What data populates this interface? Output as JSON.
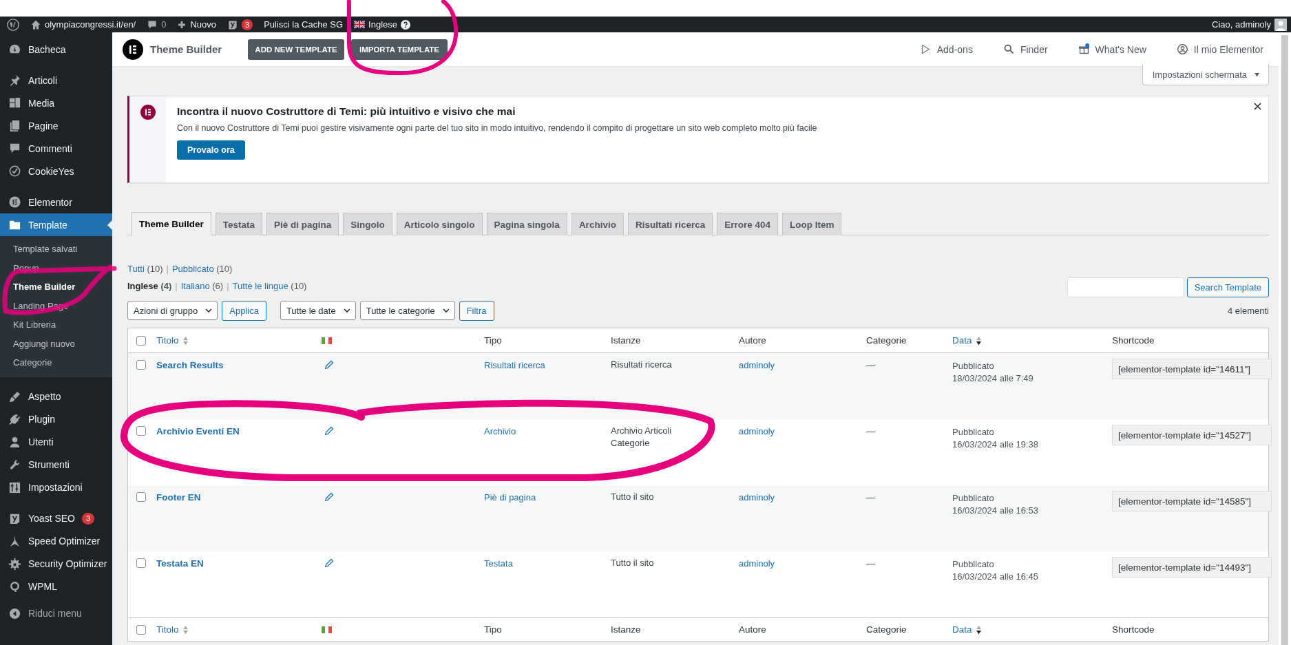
{
  "admin_bar": {
    "site": "olympiacongressi.it/en/",
    "comments": "0",
    "new_label": "Nuovo",
    "seo_count": "3",
    "cache_label": "Pulisci la Cache SG",
    "language": "Inglese",
    "greeting": "Ciao, adminoly"
  },
  "sidebar": {
    "items": [
      {
        "label": "Bacheca",
        "selected": false
      },
      {
        "label": "Articoli",
        "selected": false
      },
      {
        "label": "Media",
        "selected": false
      },
      {
        "label": "Pagine",
        "selected": false
      },
      {
        "label": "Commenti",
        "selected": false
      },
      {
        "label": "CookieYes",
        "selected": false
      },
      {
        "label": "Elementor",
        "selected": false
      },
      {
        "label": "Template",
        "selected": true,
        "children": [
          {
            "label": "Template salvati",
            "selected": false
          },
          {
            "label": "Popup",
            "selected": false
          },
          {
            "label": "Theme Builder",
            "selected": true
          },
          {
            "label": "Landing Page",
            "selected": false
          },
          {
            "label": "Kit Libreria",
            "selected": false
          },
          {
            "label": "Aggiungi nuovo",
            "selected": false
          },
          {
            "label": "Categorie",
            "selected": false
          }
        ]
      },
      {
        "label": "Aspetto",
        "selected": false
      },
      {
        "label": "Plugin",
        "selected": false
      },
      {
        "label": "Utenti",
        "selected": false
      },
      {
        "label": "Strumenti",
        "selected": false
      },
      {
        "label": "Impostazioni",
        "selected": false
      },
      {
        "label": "Yoast SEO",
        "selected": false,
        "badge": "3"
      },
      {
        "label": "Speed Optimizer",
        "selected": false
      },
      {
        "label": "Security Optimizer",
        "selected": false
      },
      {
        "label": "WPML",
        "selected": false
      }
    ],
    "collapse": "Riduci menu"
  },
  "builder_header": {
    "title": "Theme Builder",
    "buttons": [
      "ADD NEW TEMPLATE",
      "IMPORTA TEMPLATE"
    ],
    "links": [
      "Add-ons",
      "Finder",
      "What's New",
      "Il mio Elementor"
    ]
  },
  "screen_options": "Impostazioni schermata",
  "notice": {
    "title": "Incontra il nuovo Costruttore di Temi: più intuitivo e visivo che mai",
    "text": "Con il nuovo Costruttore di Temi puoi gestire visivamente ogni parte del tuo sito in modo intuitivo, rendendo il compito di progettare un sito web completo molto più facile",
    "button": "Provalo ora"
  },
  "tabs": [
    {
      "label": "Theme Builder",
      "selected": true
    },
    {
      "label": "Testata",
      "selected": false
    },
    {
      "label": "Piè di pagina",
      "selected": false
    },
    {
      "label": "Singolo",
      "selected": false
    },
    {
      "label": "Articolo singolo",
      "selected": false
    },
    {
      "label": "Pagina singola",
      "selected": false
    },
    {
      "label": "Archivio",
      "selected": false
    },
    {
      "label": "Risultati ricerca",
      "selected": false
    },
    {
      "label": "Errore 404",
      "selected": false
    },
    {
      "label": "Loop Item",
      "selected": false
    }
  ],
  "status_filters": [
    {
      "label": "Tutti",
      "count": "(10)",
      "selected": false
    },
    {
      "separator": "|",
      "label": "Pubblicato",
      "count": "(10)",
      "selected": false
    }
  ],
  "language_filters": [
    {
      "label": "Inglese",
      "count": "(4)",
      "selected": true
    },
    {
      "separator": "|",
      "label": "Italiano",
      "count": "(6)",
      "selected": false
    },
    {
      "separator": "|",
      "label": "Tutte le lingue",
      "count": "(10)",
      "selected": false
    }
  ],
  "search": {
    "button": "Search Template"
  },
  "filters": {
    "bulk_action": "Azioni di gruppo",
    "apply": "Applica",
    "date": "Tutte le date",
    "category": "Tutte le categorie",
    "filter": "Filtra",
    "count": "4 elementi"
  },
  "table": {
    "columns": [
      {
        "kind": "text",
        "label": "Titolo",
        "sortable": true,
        "sorted": false
      },
      {
        "kind": "flag"
      },
      {
        "kind": "text",
        "label": "Tipo"
      },
      {
        "kind": "text",
        "label": "Istanze"
      },
      {
        "kind": "text",
        "label": "Autore"
      },
      {
        "kind": "text",
        "label": "Categorie"
      },
      {
        "kind": "text",
        "label": "Data",
        "sortable": true,
        "sorted": true
      },
      {
        "kind": "text",
        "label": "Shortcode"
      }
    ],
    "rows": [
      {
        "checked": false,
        "title": "Search Results",
        "type": "Risultati ricerca",
        "instances": "Risultati ricerca",
        "author": "adminoly",
        "categories": "—",
        "status": "Pubblicato",
        "date": "18/03/2024 alle 7:49",
        "shortcode": "[elementor-template id=\"14611\"]"
      },
      {
        "checked": false,
        "title": "Archivio Eventi EN",
        "type": "Archivio",
        "instances": "Archivio Articoli Categorie",
        "author": "adminoly",
        "categories": "—",
        "status": "Pubblicato",
        "date": "16/03/2024 alle 19:38",
        "shortcode": "[elementor-template id=\"14527\"]"
      },
      {
        "checked": false,
        "title": "Footer EN",
        "type": "Piè di pagina",
        "instances": "Tutto il sito",
        "author": "adminoly",
        "categories": "—",
        "status": "Pubblicato",
        "date": "16/03/2024 alle 16:53",
        "shortcode": "[elementor-template id=\"14585\"]"
      },
      {
        "checked": false,
        "title": "Testata EN",
        "type": "Testata",
        "instances": "Tutto il sito",
        "author": "adminoly",
        "categories": "—",
        "status": "Pubblicato",
        "date": "16/03/2024 alle 16:45",
        "shortcode": "[elementor-template id=\"14493\"]"
      }
    ],
    "footer_columns": [
      {
        "kind": "text",
        "label": "Titolo",
        "sortable": true,
        "sorted": false
      },
      {
        "kind": "flag"
      },
      {
        "kind": "text",
        "label": "Tipo"
      },
      {
        "kind": "text",
        "label": "Istanze"
      },
      {
        "kind": "text",
        "label": "Autore"
      },
      {
        "kind": "text",
        "label": "Categorie"
      },
      {
        "kind": "text",
        "label": "Data",
        "sortable": true,
        "sorted": true
      },
      {
        "kind": "text",
        "label": "Shortcode"
      }
    ],
    "select_all_checked": false
  }
}
